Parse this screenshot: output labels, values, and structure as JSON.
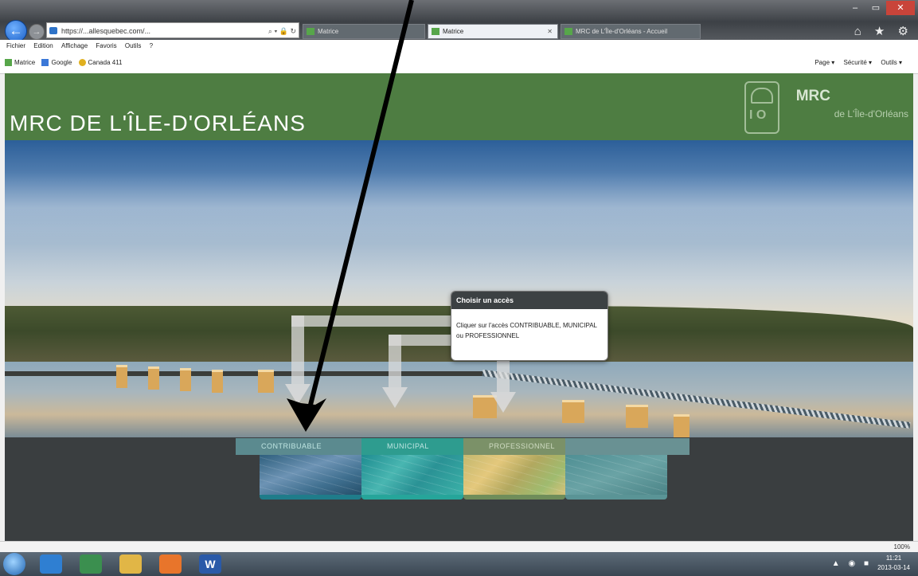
{
  "browser": {
    "address": "https://...allesquebec.com/...",
    "tabs": [
      {
        "label": "Matrice"
      },
      {
        "label": "Matrice"
      },
      {
        "label": "MRC de L'Île-d'Orléans - Accueil"
      }
    ],
    "menu": [
      "Fichier",
      "Edition",
      "Affichage",
      "Favoris",
      "Outils",
      "?"
    ],
    "favorites": [
      "Matrice",
      "Google",
      "Canada 411"
    ],
    "commands": [
      "Page ▾",
      "Sécurité ▾",
      "Outils ▾"
    ],
    "zoom": "100%",
    "window_controls": [
      "–",
      "▭",
      "✕"
    ],
    "home_icons": "⌂ ★ ⚙"
  },
  "site": {
    "title": "MRC DE L'ÎLE-D'ORLÉANS",
    "logo_mrc": "MRC",
    "logo_sub": "de L'Île-d'Orléans",
    "logo_letters": "I O"
  },
  "tooltip": {
    "title": "Choisir un accès",
    "body": "Cliquer sur l'accès CONTRIBUABLE, MUNICIPAL ou PROFESSIONNEL"
  },
  "access": {
    "contribuable": "CONTRIBUABLE",
    "municipal": "MUNICIPAL",
    "professionnel": "PROFESSIONNEL"
  },
  "taskbar": {
    "clock_time": "11:21",
    "clock_date": "2013-03-14",
    "word_letter": "W"
  },
  "colors": {
    "header_green": "#4e7d42",
    "municipal_teal": "#2e9c8f",
    "professionnel_olive": "#7b9168",
    "contribuable_blue": "#5b8a8f"
  }
}
